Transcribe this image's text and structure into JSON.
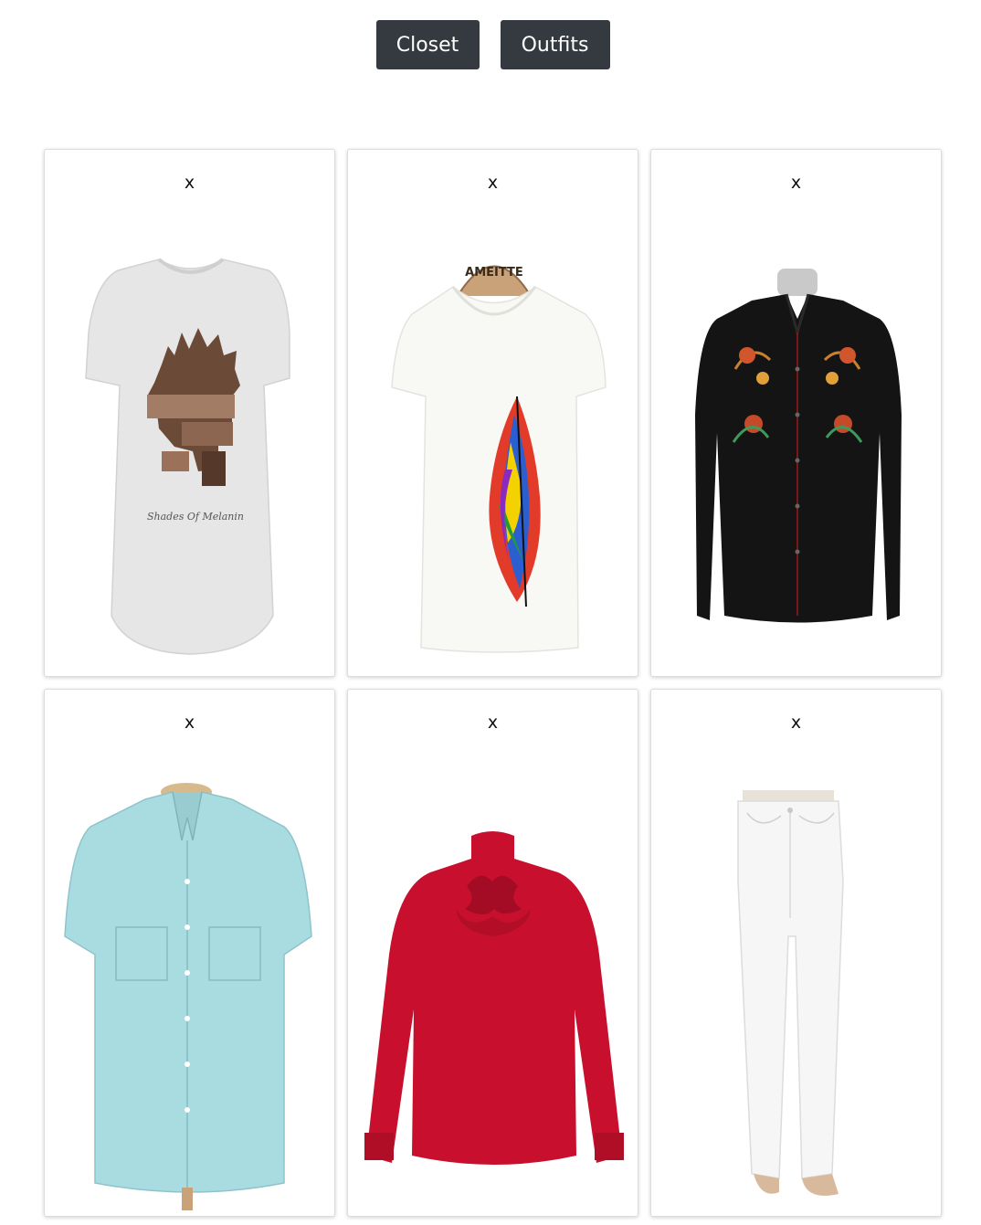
{
  "nav": {
    "closet_label": "Closet",
    "outfits_label": "Outfits"
  },
  "items": [
    {
      "remove_label": "x",
      "kind": "tee-graphic",
      "color": "#e9e9e9",
      "print_text": "Shades Of Melanin"
    },
    {
      "remove_label": "x",
      "kind": "tee-feather",
      "color": "#f8f8f4",
      "hanger_text": "AMEITTE"
    },
    {
      "remove_label": "x",
      "kind": "western-shirt",
      "color": "#141414"
    },
    {
      "remove_label": "x",
      "kind": "button-shirt",
      "color": "#a9dce0"
    },
    {
      "remove_label": "x",
      "kind": "ruffle-blouse",
      "color": "#c8102e"
    },
    {
      "remove_label": "x",
      "kind": "white-jeans",
      "color": "#f6f6f6"
    }
  ]
}
